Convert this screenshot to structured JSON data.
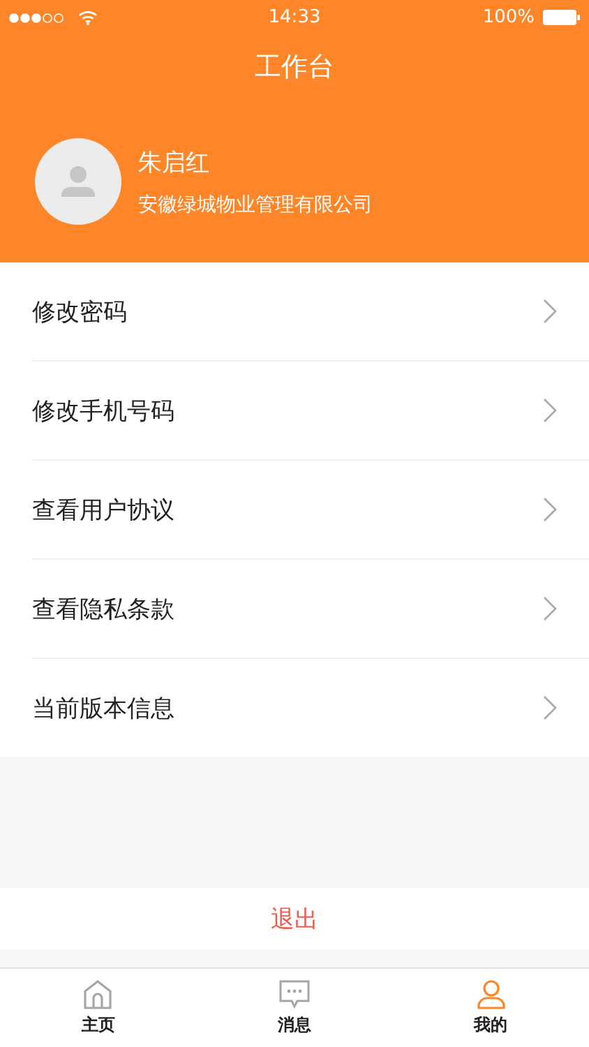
{
  "status_bar": {
    "time": "14:33",
    "battery": "100%"
  },
  "header": {
    "title": "工作台"
  },
  "profile": {
    "name": "朱启红",
    "company": "安徽绿城物业管理有限公司"
  },
  "menu": [
    {
      "label": "修改密码"
    },
    {
      "label": "修改手机号码"
    },
    {
      "label": "查看用户协议"
    },
    {
      "label": "查看隐私条款"
    },
    {
      "label": "当前版本信息"
    }
  ],
  "logout": "退出",
  "tab_bar": [
    {
      "kind": "home",
      "label": "主页",
      "selected": false
    },
    {
      "kind": "messages",
      "label": "消息",
      "selected": false
    },
    {
      "kind": "profile",
      "label": "我的",
      "selected": true
    }
  ]
}
